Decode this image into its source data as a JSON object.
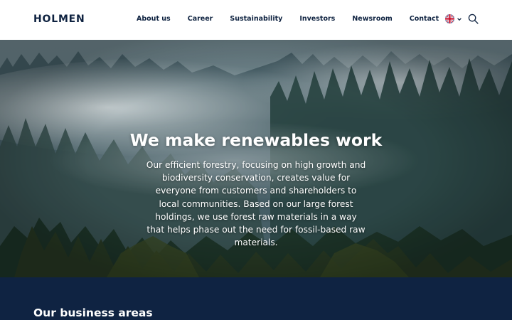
{
  "header": {
    "logo": "HOLMEN",
    "nav": [
      {
        "label": "About us"
      },
      {
        "label": "Career"
      },
      {
        "label": "Sustainability"
      },
      {
        "label": "Investors"
      },
      {
        "label": "Newsroom"
      },
      {
        "label": "Contact"
      }
    ],
    "language_icon": "uk-flag-icon",
    "search_icon": "search-icon"
  },
  "hero": {
    "title": "We make renewables work",
    "text": "Our efficient forestry, focusing on high growth and biodiversity conservation, creates value for everyone from customers and shareholders to local communities. Based on our large forest holdings, we use forest raw materials in a way that helps phase out the need for fossil-based raw materials."
  },
  "business": {
    "title": "Our business areas"
  },
  "colors": {
    "brand_navy": "#0f2342",
    "text_navy": "#0e2240",
    "white": "#ffffff"
  }
}
